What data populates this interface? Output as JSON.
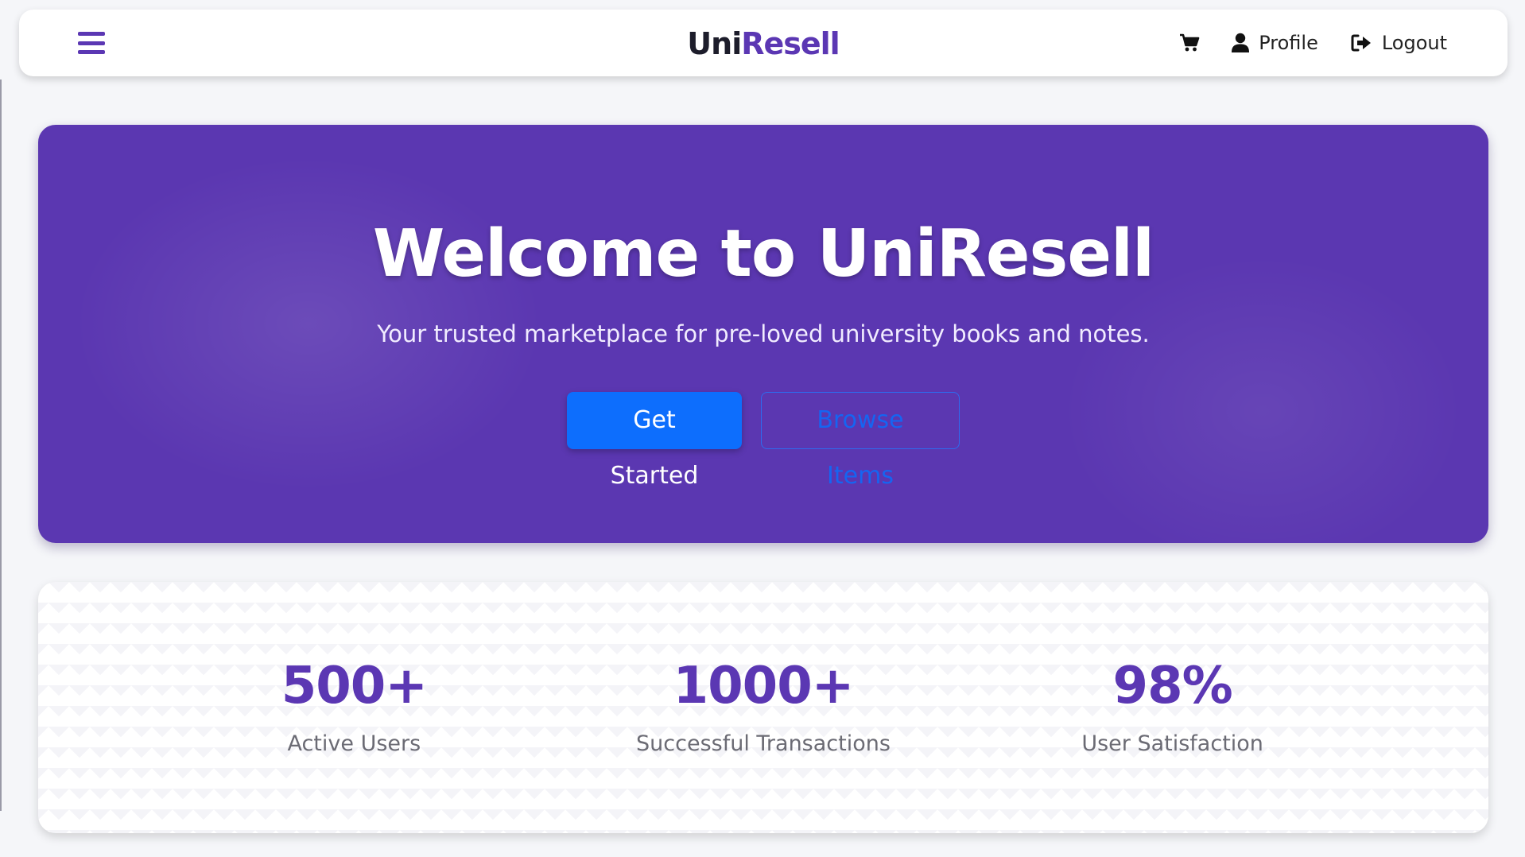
{
  "colors": {
    "brand_purple": "#5b37b3",
    "hero_bg": "#5b37b1",
    "primary_blue": "#0d6efd",
    "page_bg": "#f5f6f9"
  },
  "navbar": {
    "menu_icon": "hamburger-menu-icon",
    "brand_part1": "Uni",
    "brand_part2": "Resell",
    "cart_icon": "shopping-cart-icon",
    "profile_icon": "user-icon",
    "profile_label": "Profile",
    "logout_icon": "sign-out-icon",
    "logout_label": "Logout"
  },
  "hero": {
    "title": "Welcome to UniResell",
    "subtitle": "Your trusted marketplace for pre-loved university books and notes.",
    "primary_button": "Get Started",
    "secondary_button": "Browse Items"
  },
  "stats": [
    {
      "value": "500+",
      "label": "Active Users"
    },
    {
      "value": "1000+",
      "label": "Successful Transactions"
    },
    {
      "value": "98%",
      "label": "User Satisfaction"
    }
  ]
}
